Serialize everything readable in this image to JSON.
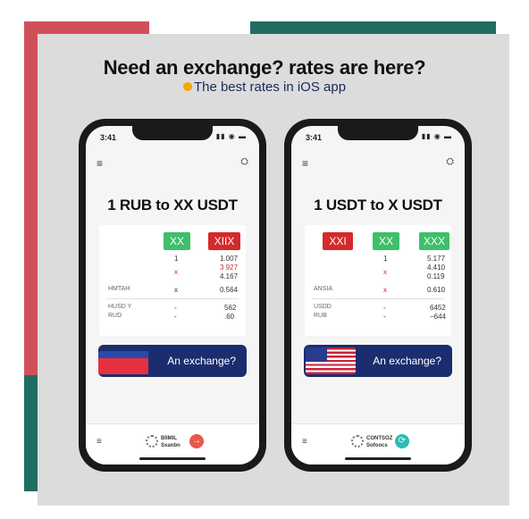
{
  "headline": "Need an exchange? rates are here?",
  "subheadline": "The best rates in iOS app",
  "phones": [
    {
      "status_time": "3:41",
      "status_icons": "▮▮ ◉ ▬",
      "menu_icon": "≡",
      "top_icon": "⛭",
      "title": "1 RUB to XX USDT",
      "chips": [
        {
          "label": "XX",
          "color": "green"
        },
        {
          "label": "XIIX",
          "color": "red"
        }
      ],
      "rows": [
        {
          "label": "",
          "mid": "1",
          "value": "1.007"
        },
        {
          "label": "",
          "mid": "x",
          "value": "3 927"
        },
        {
          "label": "",
          "mid": "",
          "value": "4.167"
        },
        {
          "label": "HMTAH",
          "mid": "x",
          "value": "0.564"
        },
        {
          "label": "HUSD Y",
          "mid": "-",
          "value": "562"
        },
        {
          "label": "RUD",
          "mid": "-",
          "value": ".60"
        }
      ],
      "cta_label": "An exchange?",
      "flag": "ru",
      "bottom_menu": "≡",
      "logo_text_1": "BIIMIL",
      "logo_text_2": "Sxanbn",
      "badge_icon": "→",
      "badge_color": "red"
    },
    {
      "status_time": "3:41",
      "status_icons": "▮▮ ◉ ▬",
      "menu_icon": "≡",
      "top_icon": "⛭",
      "title": "1 USDT  to X USDT",
      "chips": [
        {
          "label": "XXI",
          "color": "red"
        },
        {
          "label": "XX",
          "color": "green"
        },
        {
          "label": "XXX",
          "color": "green"
        }
      ],
      "rows": [
        {
          "label": "",
          "mid": "1",
          "value": "5.177"
        },
        {
          "label": "",
          "mid": "x",
          "value": "4.410"
        },
        {
          "label": "",
          "mid": "",
          "value": "0.119"
        },
        {
          "label": "ANSIA",
          "mid": "x",
          "value": "0.610"
        },
        {
          "label": "USDD",
          "mid": "-",
          "value": "6452"
        },
        {
          "label": "RUB",
          "mid": "-",
          "value": "−644"
        }
      ],
      "cta_label": "An exchange?",
      "flag": "us",
      "bottom_menu": "≡",
      "logo_text_1": "CONTSOZ",
      "logo_text_2": "Sofoocs",
      "badge_icon": "⟳",
      "badge_color": "teal"
    }
  ]
}
